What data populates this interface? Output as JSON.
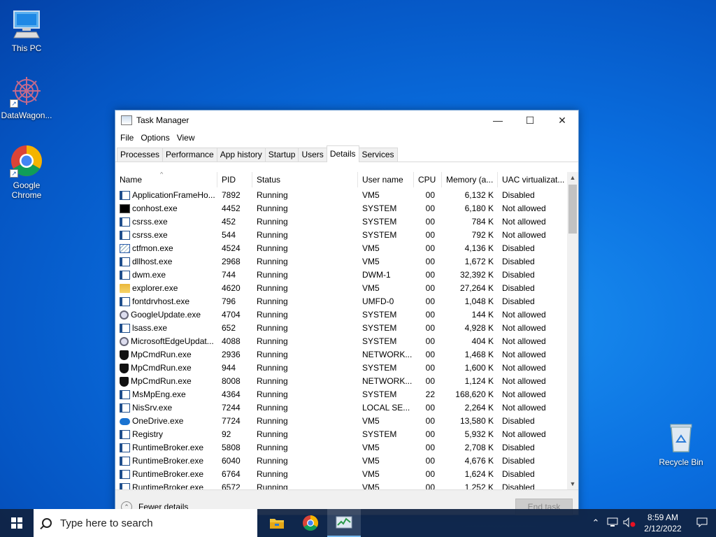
{
  "desktop": {
    "icons": [
      {
        "label": "This PC",
        "icon": "computer-icon"
      },
      {
        "label": "DataWagon...",
        "icon": "datawagon-icon"
      },
      {
        "label": "Google Chrome",
        "icon": "chrome-icon"
      },
      {
        "label": "Recycle Bin",
        "icon": "recycle-bin-icon"
      }
    ]
  },
  "window": {
    "title": "Task Manager",
    "controls": {
      "minimize": "—",
      "maximize": "☐",
      "close": "✕"
    },
    "menu": [
      "File",
      "Options",
      "View"
    ],
    "tabs": [
      "Processes",
      "Performance",
      "App history",
      "Startup",
      "Users",
      "Details",
      "Services"
    ],
    "active_tab": "Details",
    "columns": [
      "Name",
      "PID",
      "Status",
      "User name",
      "CPU",
      "Memory (a...",
      "UAC virtualizat..."
    ],
    "rows": [
      {
        "icon": "app",
        "name": "ApplicationFrameHo...",
        "pid": "7892",
        "status": "Running",
        "user": "VM5",
        "cpu": "00",
        "mem": "6,132 K",
        "uac": "Disabled"
      },
      {
        "icon": "cmd",
        "name": "conhost.exe",
        "pid": "4452",
        "status": "Running",
        "user": "SYSTEM",
        "cpu": "00",
        "mem": "6,180 K",
        "uac": "Not allowed"
      },
      {
        "icon": "app",
        "name": "csrss.exe",
        "pid": "452",
        "status": "Running",
        "user": "SYSTEM",
        "cpu": "00",
        "mem": "784 K",
        "uac": "Not allowed"
      },
      {
        "icon": "app",
        "name": "csrss.exe",
        "pid": "544",
        "status": "Running",
        "user": "SYSTEM",
        "cpu": "00",
        "mem": "792 K",
        "uac": "Not allowed"
      },
      {
        "icon": "pen",
        "name": "ctfmon.exe",
        "pid": "4524",
        "status": "Running",
        "user": "VM5",
        "cpu": "00",
        "mem": "4,136 K",
        "uac": "Disabled"
      },
      {
        "icon": "app",
        "name": "dllhost.exe",
        "pid": "2968",
        "status": "Running",
        "user": "VM5",
        "cpu": "00",
        "mem": "1,672 K",
        "uac": "Disabled"
      },
      {
        "icon": "app",
        "name": "dwm.exe",
        "pid": "744",
        "status": "Running",
        "user": "DWM-1",
        "cpu": "00",
        "mem": "32,392 K",
        "uac": "Disabled"
      },
      {
        "icon": "folder",
        "name": "explorer.exe",
        "pid": "4620",
        "status": "Running",
        "user": "VM5",
        "cpu": "00",
        "mem": "27,264 K",
        "uac": "Disabled"
      },
      {
        "icon": "app",
        "name": "fontdrvhost.exe",
        "pid": "796",
        "status": "Running",
        "user": "UMFD-0",
        "cpu": "00",
        "mem": "1,048 K",
        "uac": "Disabled"
      },
      {
        "icon": "gear",
        "name": "GoogleUpdate.exe",
        "pid": "4704",
        "status": "Running",
        "user": "SYSTEM",
        "cpu": "00",
        "mem": "144 K",
        "uac": "Not allowed"
      },
      {
        "icon": "app",
        "name": "lsass.exe",
        "pid": "652",
        "status": "Running",
        "user": "SYSTEM",
        "cpu": "00",
        "mem": "4,928 K",
        "uac": "Not allowed"
      },
      {
        "icon": "gear",
        "name": "MicrosoftEdgeUpdat...",
        "pid": "4088",
        "status": "Running",
        "user": "SYSTEM",
        "cpu": "00",
        "mem": "404 K",
        "uac": "Not allowed"
      },
      {
        "icon": "shield",
        "name": "MpCmdRun.exe",
        "pid": "2936",
        "status": "Running",
        "user": "NETWORK...",
        "cpu": "00",
        "mem": "1,468 K",
        "uac": "Not allowed"
      },
      {
        "icon": "shield",
        "name": "MpCmdRun.exe",
        "pid": "944",
        "status": "Running",
        "user": "SYSTEM",
        "cpu": "00",
        "mem": "1,600 K",
        "uac": "Not allowed"
      },
      {
        "icon": "shield",
        "name": "MpCmdRun.exe",
        "pid": "8008",
        "status": "Running",
        "user": "NETWORK...",
        "cpu": "00",
        "mem": "1,124 K",
        "uac": "Not allowed"
      },
      {
        "icon": "app",
        "name": "MsMpEng.exe",
        "pid": "4364",
        "status": "Running",
        "user": "SYSTEM",
        "cpu": "22",
        "mem": "168,620 K",
        "uac": "Not allowed"
      },
      {
        "icon": "app",
        "name": "NisSrv.exe",
        "pid": "7244",
        "status": "Running",
        "user": "LOCAL SE...",
        "cpu": "00",
        "mem": "2,264 K",
        "uac": "Not allowed"
      },
      {
        "icon": "cloud",
        "name": "OneDrive.exe",
        "pid": "7724",
        "status": "Running",
        "user": "VM5",
        "cpu": "00",
        "mem": "13,580 K",
        "uac": "Disabled"
      },
      {
        "icon": "app",
        "name": "Registry",
        "pid": "92",
        "status": "Running",
        "user": "SYSTEM",
        "cpu": "00",
        "mem": "5,932 K",
        "uac": "Not allowed"
      },
      {
        "icon": "app",
        "name": "RuntimeBroker.exe",
        "pid": "5808",
        "status": "Running",
        "user": "VM5",
        "cpu": "00",
        "mem": "2,708 K",
        "uac": "Disabled"
      },
      {
        "icon": "app",
        "name": "RuntimeBroker.exe",
        "pid": "6040",
        "status": "Running",
        "user": "VM5",
        "cpu": "00",
        "mem": "4,676 K",
        "uac": "Disabled"
      },
      {
        "icon": "app",
        "name": "RuntimeBroker.exe",
        "pid": "6764",
        "status": "Running",
        "user": "VM5",
        "cpu": "00",
        "mem": "1,624 K",
        "uac": "Disabled"
      },
      {
        "icon": "app",
        "name": "RuntimeBroker.exe",
        "pid": "6572",
        "status": "Running",
        "user": "VM5",
        "cpu": "00",
        "mem": "1,252 K",
        "uac": "Disabled"
      }
    ],
    "footer": {
      "fewer_details": "Fewer details",
      "end_task": "End task"
    }
  },
  "taskbar": {
    "search_placeholder": "Type here to search",
    "apps": [
      {
        "name": "file-explorer-icon",
        "active": false
      },
      {
        "name": "chrome-icon",
        "active": false
      },
      {
        "name": "task-manager-icon",
        "active": true
      }
    ],
    "time": "8:59 AM",
    "date": "2/12/2022"
  },
  "colors": {
    "desktop": "#0a6fe0",
    "taskbar": "#102242",
    "accent": "#76b9ed"
  }
}
